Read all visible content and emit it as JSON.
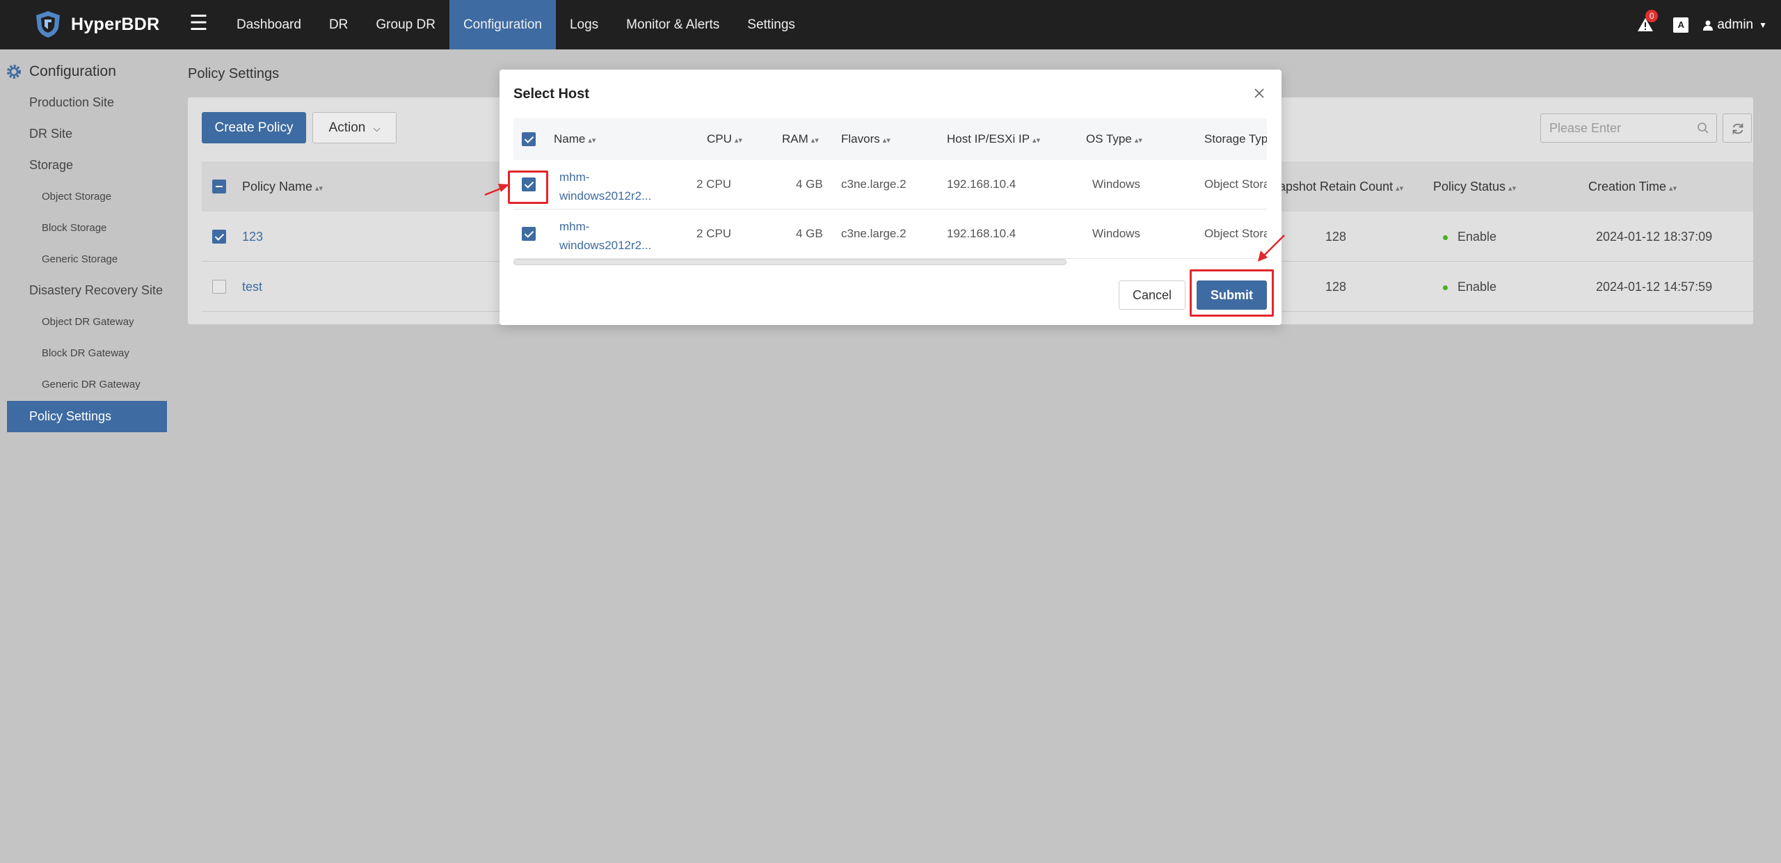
{
  "app": {
    "name": "HyperBDR",
    "menu_icon": "hamburger-icon"
  },
  "nav": {
    "items": [
      "Dashboard",
      "DR",
      "Group DR",
      "Configuration",
      "Logs",
      "Monitor & Alerts",
      "Settings"
    ],
    "active": "Configuration"
  },
  "topbar": {
    "alert_count": "0",
    "lang_icon_text": "A",
    "user": "admin"
  },
  "sidebar": {
    "title": "Configuration",
    "production_site": "Production Site",
    "dr_site": "DR Site",
    "storage": "Storage",
    "object_storage": "Object Storage",
    "block_storage": "Block Storage",
    "generic_storage": "Generic Storage",
    "disaster_recovery_site": "Disastery Recovery Site",
    "object_dr_gateway": "Object DR Gateway",
    "block_dr_gateway": "Block DR Gateway",
    "generic_dr_gateway": "Generic DR Gateway",
    "policy_settings": "Policy Settings"
  },
  "main": {
    "page_title": "Policy Settings",
    "create_policy": "Create Policy",
    "action": "Action",
    "search_placeholder": "Please Enter",
    "columns": {
      "policy_name": "Policy Name",
      "snapshot_retain_count": "apshot Retain Count",
      "policy_status": "Policy Status",
      "creation_time": "Creation Time"
    },
    "rows": [
      {
        "name": "123",
        "retain": "128",
        "status": "Enable",
        "created": "2024-01-12 18:37:09",
        "checked": true
      },
      {
        "name": "test",
        "retain": "128",
        "status": "Enable",
        "created": "2024-01-12 14:57:59",
        "checked": false
      }
    ]
  },
  "modal": {
    "title": "Select Host",
    "columns": {
      "name": "Name",
      "cpu": "CPU",
      "ram": "RAM",
      "flavors": "Flavors",
      "host_ip": "Host IP/ESXi IP",
      "os_type": "OS Type",
      "storage_type": "Storage Typ"
    },
    "rows": [
      {
        "name_line1": "mhm-",
        "name_line2": "windows2012r2...",
        "cpu": "2 CPU",
        "ram": "4 GB",
        "flavors": "c3ne.large.2",
        "ip": "192.168.10.4",
        "os": "Windows",
        "storage": "Object Stora",
        "checked": true
      },
      {
        "name_line1": "mhm-",
        "name_line2": "windows2012r2...",
        "cpu": "2 CPU",
        "ram": "4 GB",
        "flavors": "c3ne.large.2",
        "ip": "192.168.10.4",
        "os": "Windows",
        "storage": "Object Stora",
        "checked": true
      }
    ],
    "cancel": "Cancel",
    "submit": "Submit"
  },
  "colors": {
    "topbar_bg": "#202020",
    "accent": "#3e6ba1",
    "highlight": "#e3262a",
    "status_enable": "#4caf1a"
  }
}
